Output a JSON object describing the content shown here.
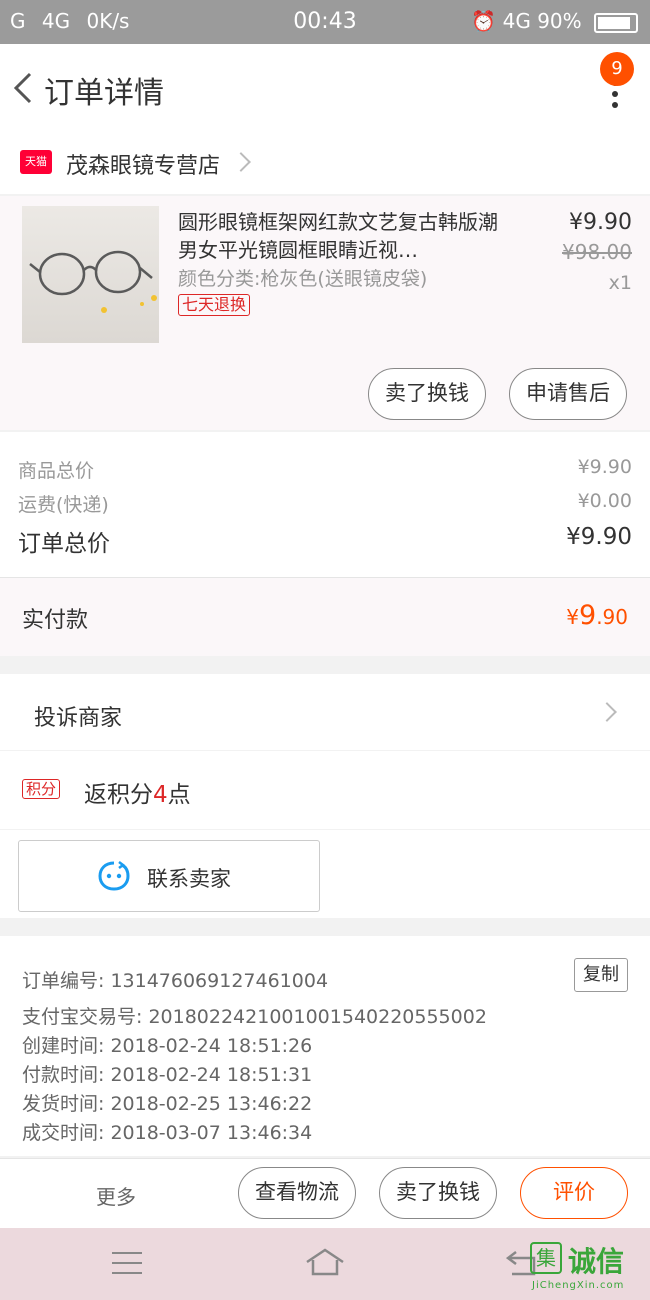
{
  "status_bar": {
    "left": "G    4G    0K/s",
    "time": "00:43",
    "network": "4G",
    "battery": "90%",
    "battery_level": 0.9
  },
  "nav": {
    "title": "订单详情",
    "badge_count": "9"
  },
  "shop": {
    "platform_tag": "天猫",
    "name": "茂森眼镜专营店"
  },
  "item": {
    "title": "圆形眼镜框架网红款文艺复古韩版潮男女平光镜圆框眼睛近视…",
    "spec": "颜色分类:枪灰色(送眼镜皮袋)",
    "return_tag": "七天退换",
    "price": "¥9.90",
    "original_price": "¥98.00",
    "quantity": "x1",
    "buttons": {
      "sell": "卖了换钱",
      "after_sale": "申请售后"
    }
  },
  "price_summary": {
    "goods_label": "商品总价",
    "goods_value": "¥9.90",
    "shipping_label": "运费(快递)",
    "shipping_value": "¥0.00",
    "total_label": "订单总价",
    "total_value": "¥9.90"
  },
  "paid": {
    "label": "实付款",
    "currency": "¥",
    "integer": "9",
    "decimal": ".90"
  },
  "complain": {
    "label": "投诉商家"
  },
  "points": {
    "tag": "积分",
    "text_before": "返积分",
    "value": "4",
    "text_after": "点"
  },
  "contact": {
    "label": "联系卖家"
  },
  "order_info": {
    "order_no": "订单编号: 131476069127461004",
    "copy_label": "复制",
    "alipay_no": "支付宝交易号: 2018022421001001540220555002",
    "created": "创建时间: 2018-02-24 18:51:26",
    "paid_time": "付款时间: 2018-02-24 18:51:31",
    "shipped": "发货时间: 2018-02-25 13:46:22",
    "completed": "成交时间: 2018-03-07 13:46:34"
  },
  "action_bar": {
    "more": "更多",
    "logistics": "查看物流",
    "sell": "卖了换钱",
    "review": "评价"
  },
  "watermark": {
    "logo": "集",
    "text": "诚信",
    "sub": "JiChengXin.com"
  },
  "colors": {
    "accent": "#ff5000",
    "tag_red": "#dd2727",
    "tmall": "#ff0036",
    "status_bar": "#9b9b9b",
    "nav_bg": "#ecd9dd"
  }
}
